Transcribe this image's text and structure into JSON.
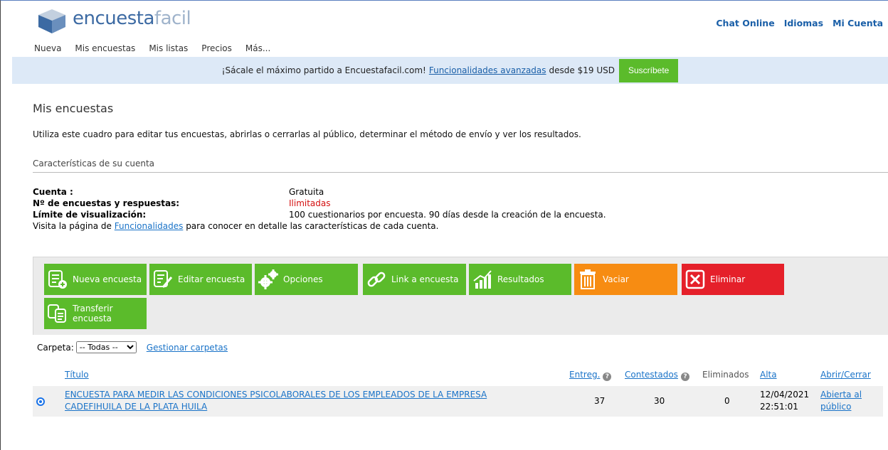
{
  "header": {
    "logo": {
      "main": "encuesta",
      "accent": "facil"
    },
    "nav": [
      "Nueva",
      "Mis encuestas",
      "Mis listas",
      "Precios",
      "Más..."
    ],
    "right_nav": [
      "Chat Online",
      "Idiomas",
      "Mi Cuenta"
    ]
  },
  "promo": {
    "text_before": "¡Sácale el máximo partido a Encuestafacil.com!",
    "link": "Funcionalidades avanzadas",
    "text_after": "desde $19 USD",
    "button": "Suscríbete"
  },
  "page": {
    "title": "Mis encuestas",
    "description": "Utiliza este cuadro para editar tus encuestas, abrirlas o cerrarlas al público, determinar el método de envío y ver los resultados.",
    "section_title": "Características de su cuenta"
  },
  "account": {
    "cuenta_label": "Cuenta :",
    "cuenta_value": "Gratuita",
    "encuestas_label": "Nº de encuestas y respuestas:",
    "encuestas_value": "Ilimitadas",
    "limite_label": "Límite de visualización:",
    "limite_value": "100 cuestionarios por encuesta. 90 días desde la creación de la encuesta.",
    "visit_before": "Visita la página de",
    "visit_link": "Funcionalidades",
    "visit_after": "para conocer en detalle las características de cada cuenta."
  },
  "toolbar": {
    "nueva": "Nueva encuesta",
    "editar": "Editar encuesta",
    "opciones": "Opciones",
    "link": "Link a encuesta",
    "resultados": "Resultados",
    "vaciar": "Vaciar",
    "eliminar": "Eliminar",
    "transferir_1": "Transferir",
    "transferir_2": "encuesta",
    "colors": {
      "green": "#5bbb2b",
      "orange": "#f78c12",
      "red": "#e5202a"
    },
    "icons": [
      "new-survey-icon",
      "edit-survey-icon",
      "gears-icon",
      "link-icon",
      "results-chart-icon",
      "trash-icon",
      "delete-x-icon",
      "transfer-icon"
    ]
  },
  "folder": {
    "label": "Carpeta:",
    "selected": "-- Todas --",
    "manage_link": "Gestionar carpetas"
  },
  "table": {
    "headers": {
      "titulo": "Título",
      "entreg": "Entreg.",
      "contestados": "Contestados",
      "eliminados": "Eliminados",
      "alta": "Alta",
      "abrir": "Abrir/Cerrar"
    },
    "rows": [
      {
        "title_line1": "ENCUESTA PARA MEDIR LAS CONDICIONES PSICOLABORALES DE LOS EMPLEADOS DE LA EMPRESA",
        "title_line2": "CADEFIHUILA DE LA PLATA HUILA",
        "entreg": "37",
        "contestados": "30",
        "eliminados": "0",
        "alta_date": "12/04/2021",
        "alta_time": "22:51:01",
        "status_line1": "Abierta al",
        "status_line2": "público"
      }
    ]
  }
}
